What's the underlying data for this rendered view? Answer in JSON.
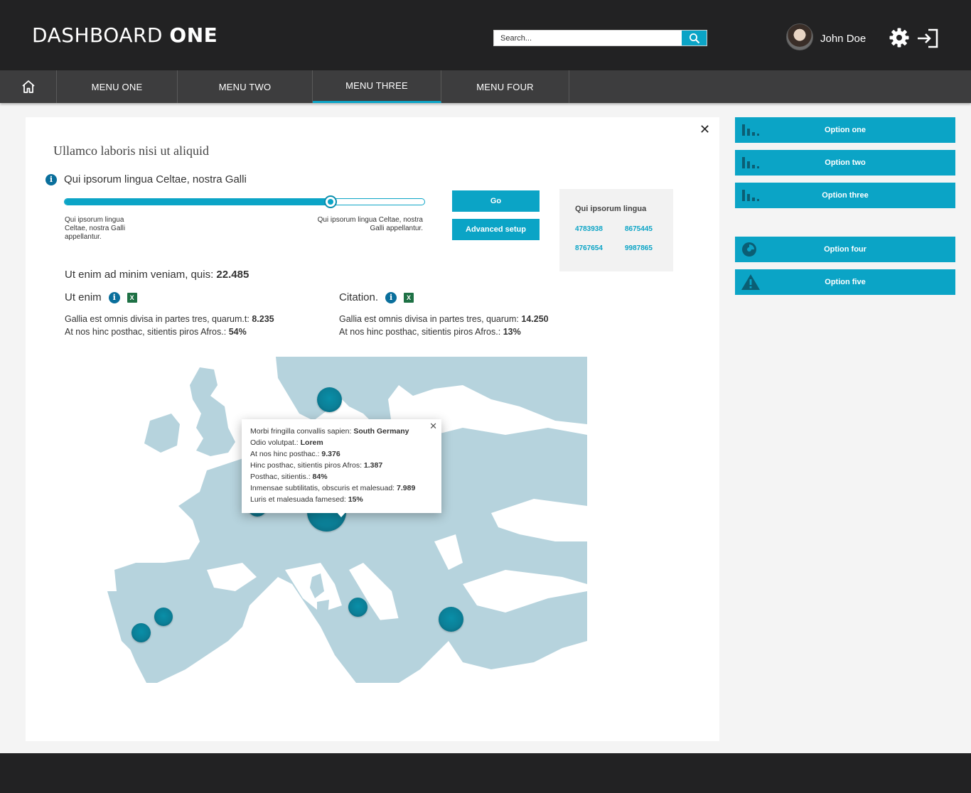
{
  "header": {
    "brand_light": "DASHBOARD",
    "brand_bold": "ONE",
    "search_placeholder": "Search...",
    "user_name": "John Doe"
  },
  "nav": {
    "items": [
      {
        "label": "MENU ONE"
      },
      {
        "label": "MENU TWO"
      },
      {
        "label": "MENU THREE",
        "active": true
      },
      {
        "label": "MENU FOUR"
      }
    ]
  },
  "panel": {
    "title": "Ullamco laboris nisi ut aliquid",
    "slider": {
      "label": "Qui ipsorum lingua Celtae, nostra Galli",
      "value_fraction": 0.74,
      "min_label": "Qui ipsorum lingua Celtae, nostra Galli appellantur.",
      "max_label": "Qui ipsorum lingua Celtae, nostra Galli appellantur."
    },
    "buttons": {
      "go": "Go",
      "advanced": "Advanced setup"
    },
    "codes": {
      "title": "Qui ipsorum lingua",
      "values": [
        "4783938",
        "8675445",
        "8767654",
        "9987865"
      ]
    },
    "summary": {
      "label": "Ut enim ad minim veniam, quis:",
      "value": "22.485"
    },
    "section_left": {
      "title": "Ut enim",
      "line1_label": "Gallia est omnis divisa in partes tres, quarum.t:",
      "line1_value": "8.235",
      "line2_label": "At nos hinc posthac, sitientis piros Afros.:",
      "line2_value": "54%"
    },
    "section_right": {
      "title": "Citation.",
      "line1_label": "Gallia est omnis divisa in partes tres, quarum:",
      "line1_value": "14.250",
      "line2_label": "At nos hinc posthac, sitientis piros Afros.:",
      "line2_value": "13%"
    },
    "tooltip": {
      "rows": [
        {
          "label": "Morbi fringilla convallis sapien:",
          "value": "South Germany"
        },
        {
          "label": "Odio volutpat.:",
          "value": "Lorem"
        },
        {
          "label": "At nos hinc posthac.:",
          "value": "9.376"
        },
        {
          "label": "Hinc posthac, sitientis piros Afros:",
          "value": "1.387"
        },
        {
          "label": "Posthac, sitientis.:",
          "value": "84%"
        },
        {
          "label": "Inmensae subtilitatis, obscuris et malesuad:",
          "value": "7.989"
        },
        {
          "label": "Luris et malesuada famesed:",
          "value": "15%"
        }
      ]
    }
  },
  "options": [
    {
      "label": "Option one",
      "icon": "bar-chart-icon"
    },
    {
      "label": "Option two",
      "icon": "bar-chart-icon"
    },
    {
      "label": "Option three",
      "icon": "bar-chart-icon"
    },
    {
      "label": "Option four",
      "icon": "pie-chart-icon"
    },
    {
      "label": "Option five",
      "icon": "warning-icon"
    }
  ],
  "colors": {
    "accent": "#0ba4c6",
    "header_bg": "#222223",
    "nav_bg": "#3d3d3e",
    "map_land": "#b6d3dd"
  }
}
